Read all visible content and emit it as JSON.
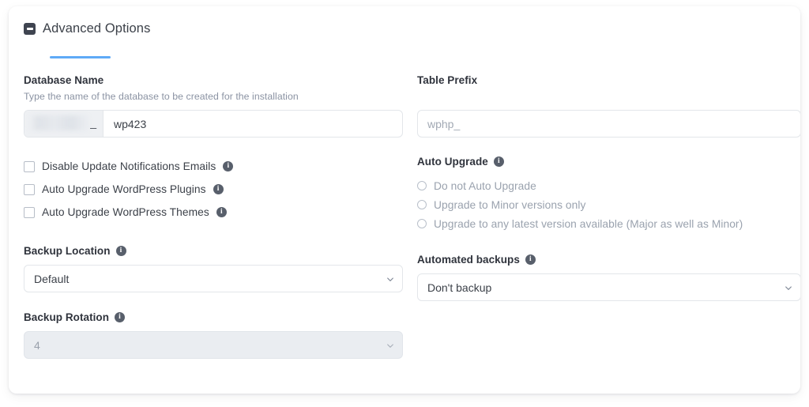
{
  "panel": {
    "title": "Advanced Options",
    "collapse_icon": "minus-square-icon",
    "accent_color": "#5faaf7"
  },
  "database_name": {
    "label": "Database Name",
    "help": "Type the name of the database to be created for the installation",
    "prefix_redacted": "",
    "prefix_separator": "_",
    "value": "wp423"
  },
  "table_prefix": {
    "label": "Table Prefix",
    "value": "wphp_"
  },
  "checkboxes": [
    {
      "label": "Disable Update Notifications Emails",
      "checked": false,
      "info": "i"
    },
    {
      "label": "Auto Upgrade WordPress Plugins",
      "checked": false,
      "info": "i"
    },
    {
      "label": "Auto Upgrade WordPress Themes",
      "checked": false,
      "info": "i"
    }
  ],
  "auto_upgrade": {
    "label": "Auto Upgrade",
    "info": "i",
    "options": [
      {
        "label": "Do not Auto Upgrade",
        "selected": false
      },
      {
        "label": "Upgrade to Minor versions only",
        "selected": false
      },
      {
        "label": "Upgrade to any latest version available (Major as well as Minor)",
        "selected": false
      }
    ]
  },
  "backup_location": {
    "label": "Backup Location",
    "info": "i",
    "value": "Default"
  },
  "automated_backups": {
    "label": "Automated backups",
    "info": "i",
    "value": "Don't backup"
  },
  "backup_rotation": {
    "label": "Backup Rotation",
    "info": "i",
    "value": "4",
    "disabled": true
  }
}
